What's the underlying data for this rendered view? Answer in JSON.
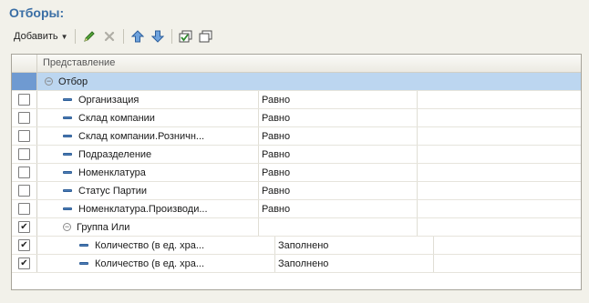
{
  "title": "Отборы:",
  "toolbar": {
    "add_label": "Добавить",
    "icons": [
      "edit-icon",
      "delete-icon",
      "move-up-icon",
      "move-down-icon",
      "check-all-icon",
      "uncheck-all-icon"
    ]
  },
  "grid": {
    "header": "Представление",
    "rows": [
      {
        "name": "Отбор",
        "condition": "",
        "checked": false,
        "group": true,
        "level": 0,
        "selected": true
      },
      {
        "name": "Организация",
        "condition": "Равно",
        "checked": false,
        "level": 1
      },
      {
        "name": "Склад компании",
        "condition": "Равно",
        "checked": false,
        "level": 1
      },
      {
        "name": "Склад компании.Розничн...",
        "condition": "Равно",
        "checked": false,
        "level": 1
      },
      {
        "name": "Подразделение",
        "condition": "Равно",
        "checked": false,
        "level": 1
      },
      {
        "name": "Номенклатура",
        "condition": "Равно",
        "checked": false,
        "level": 1
      },
      {
        "name": "Статус Партии",
        "condition": "Равно",
        "checked": false,
        "level": 1
      },
      {
        "name": "Номенклатура.Производи...",
        "condition": "Равно",
        "checked": false,
        "level": 1
      },
      {
        "name": "Группа Или",
        "condition": "",
        "checked": true,
        "group": true,
        "level": 1
      },
      {
        "name": "Количество (в ед. хра...",
        "condition": "Заполнено",
        "checked": true,
        "level": 2
      },
      {
        "name": "Количество (в ед. хра...",
        "condition": "Заполнено",
        "checked": true,
        "level": 2
      }
    ]
  },
  "colors": {
    "title": "#3a6ea5",
    "selected_row": "#bcd6f0"
  }
}
